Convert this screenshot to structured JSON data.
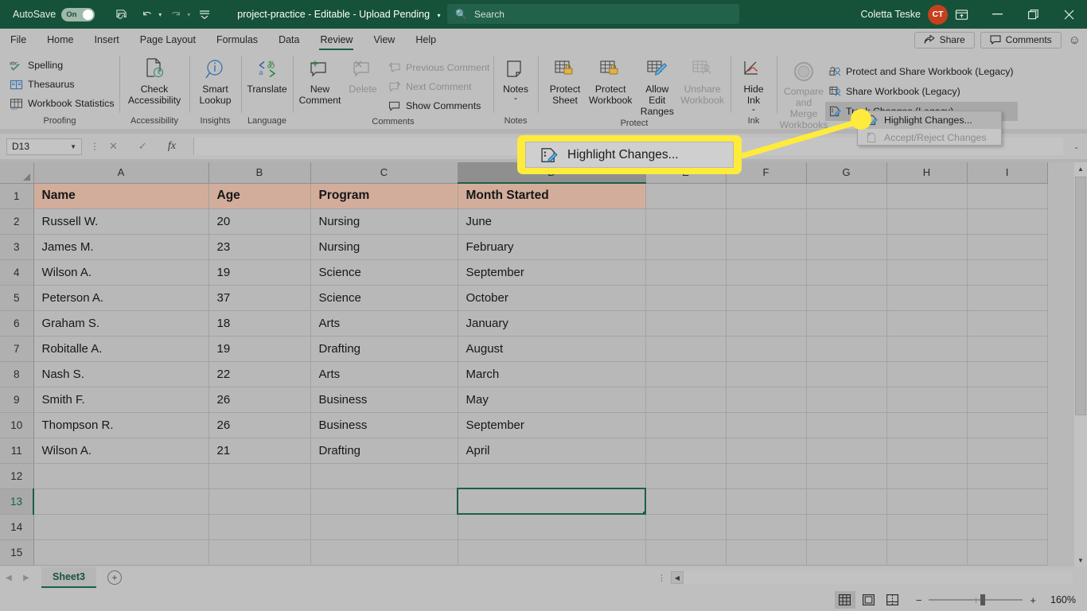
{
  "titlebar": {
    "autosave_label": "AutoSave",
    "autosave_state": "On",
    "save_icon": "save-icon",
    "undo_icon": "undo-icon",
    "redo_icon": "redo-icon",
    "customize_icon": "customize-quick-access-icon",
    "document_title": "project-practice  -  Editable  -  Upload Pending",
    "search_placeholder": "Search",
    "user_name": "Coletta Teske",
    "user_initials": "CT",
    "ribbon_display_icon": "ribbon-display-options-icon",
    "minimize_icon": "minimize-icon",
    "restore_icon": "restore-icon",
    "close_icon": "close-icon"
  },
  "tabs": [
    {
      "label": "File",
      "active": false
    },
    {
      "label": "Home",
      "active": false
    },
    {
      "label": "Insert",
      "active": false
    },
    {
      "label": "Page Layout",
      "active": false
    },
    {
      "label": "Formulas",
      "active": false
    },
    {
      "label": "Data",
      "active": false
    },
    {
      "label": "Review",
      "active": true
    },
    {
      "label": "View",
      "active": false
    },
    {
      "label": "Help",
      "active": false
    }
  ],
  "tab_right": {
    "share_label": "Share",
    "comments_label": "Comments",
    "feedback_icon": "smiley-face-icon"
  },
  "ribbon": {
    "groups": [
      {
        "title": "Proofing",
        "small_items": [
          {
            "label": "Spelling",
            "icon": "spelling-abc-check-icon",
            "disabled": false
          },
          {
            "label": "Thesaurus",
            "icon": "thesaurus-book-icon",
            "disabled": false
          },
          {
            "label": "Workbook Statistics",
            "icon": "workbook-statistics-icon",
            "disabled": false
          }
        ]
      },
      {
        "title": "Accessibility",
        "big_items": [
          {
            "label": "Check\nAccessibility",
            "icon": "check-accessibility-icon",
            "disabled": false
          }
        ]
      },
      {
        "title": "Insights",
        "big_items": [
          {
            "label": "Smart\nLookup",
            "icon": "smart-lookup-icon",
            "disabled": false
          }
        ]
      },
      {
        "title": "Language",
        "big_items": [
          {
            "label": "Translate",
            "icon": "translate-icon",
            "disabled": false
          }
        ]
      },
      {
        "title": "Comments",
        "big_items": [
          {
            "label": "New\nComment",
            "icon": "new-comment-icon",
            "disabled": false
          },
          {
            "label": "Delete",
            "icon": "delete-comment-icon",
            "disabled": true
          }
        ],
        "small_items": [
          {
            "label": "Previous Comment",
            "icon": "previous-comment-icon",
            "disabled": true
          },
          {
            "label": "Next Comment",
            "icon": "next-comment-icon",
            "disabled": true
          },
          {
            "label": "Show Comments",
            "icon": "show-comments-icon",
            "disabled": false
          }
        ]
      },
      {
        "title": "Notes",
        "big_items": [
          {
            "label": "Notes",
            "icon": "notes-icon",
            "disabled": false,
            "caret": true
          }
        ]
      },
      {
        "title": "Protect",
        "big_items": [
          {
            "label": "Protect\nSheet",
            "icon": "protect-sheet-icon",
            "disabled": false
          },
          {
            "label": "Protect\nWorkbook",
            "icon": "protect-workbook-icon",
            "disabled": false
          },
          {
            "label": "Allow Edit\nRanges",
            "icon": "allow-edit-ranges-icon",
            "disabled": false
          },
          {
            "label": "Unshare\nWorkbook",
            "icon": "unshare-workbook-icon",
            "disabled": true
          }
        ]
      },
      {
        "title": "Ink",
        "big_items": [
          {
            "label": "Hide\nInk",
            "icon": "hide-ink-icon",
            "disabled": false,
            "caret": true
          }
        ]
      },
      {
        "title": "",
        "big_items": [
          {
            "label": "Compare and\nMerge Workbooks",
            "icon": "compare-merge-workbooks-icon",
            "disabled": true
          }
        ],
        "small_items": [
          {
            "label": "Protect and Share Workbook (Legacy)",
            "icon": "protect-share-workbook-icon",
            "disabled": false
          },
          {
            "label": "Share Workbook (Legacy)",
            "icon": "share-workbook-icon",
            "disabled": false
          },
          {
            "label": "Track Changes (Legacy)",
            "icon": "track-changes-icon",
            "disabled": false,
            "highlighted": true,
            "caret": true
          }
        ]
      }
    ]
  },
  "dropdown": {
    "items": [
      {
        "label": "Highlight Changes...",
        "icon": "highlight-changes-icon",
        "highlighted": true,
        "disabled": false
      },
      {
        "label": "Accept/Reject Changes",
        "icon": "accept-reject-changes-icon",
        "highlighted": false,
        "disabled": true
      }
    ]
  },
  "callout": {
    "label": "Highlight Changes...",
    "icon": "highlight-changes-icon",
    "border_color": "#ffeb3b"
  },
  "formulabar": {
    "namebox_value": "D13",
    "cancel_icon": "cancel-icon",
    "enter_icon": "confirm-checkmark-icon",
    "function_icon": "insert-function-fx-icon",
    "formula_value": "",
    "expand_icon": "expand-formula-bar-icon"
  },
  "grid": {
    "columns": [
      "A",
      "B",
      "C",
      "D",
      "E",
      "F",
      "G",
      "H",
      "I"
    ],
    "selected_column": "D",
    "selected_row": 13,
    "selected_cell": "D13",
    "rows": [
      {
        "num": 1,
        "cells": [
          "Name",
          "Age",
          "Program",
          "Month Started",
          "",
          "",
          "",
          "",
          ""
        ],
        "header": true
      },
      {
        "num": 2,
        "cells": [
          "Russell W.",
          "20",
          "Nursing",
          "June",
          "",
          "",
          "",
          "",
          ""
        ]
      },
      {
        "num": 3,
        "cells": [
          "James M.",
          "23",
          "Nursing",
          "February",
          "",
          "",
          "",
          "",
          ""
        ]
      },
      {
        "num": 4,
        "cells": [
          "Wilson A.",
          "19",
          "Science",
          "September",
          "",
          "",
          "",
          "",
          ""
        ]
      },
      {
        "num": 5,
        "cells": [
          "Peterson A.",
          "37",
          "Science",
          "October",
          "",
          "",
          "",
          "",
          ""
        ]
      },
      {
        "num": 6,
        "cells": [
          "Graham S.",
          "18",
          "Arts",
          "January",
          "",
          "",
          "",
          "",
          ""
        ]
      },
      {
        "num": 7,
        "cells": [
          "Robitalle A.",
          "19",
          "Drafting",
          "August",
          "",
          "",
          "",
          "",
          ""
        ]
      },
      {
        "num": 8,
        "cells": [
          "Nash S.",
          "22",
          "Arts",
          "March",
          "",
          "",
          "",
          "",
          ""
        ]
      },
      {
        "num": 9,
        "cells": [
          "Smith F.",
          "26",
          "Business",
          "May",
          "",
          "",
          "",
          "",
          ""
        ]
      },
      {
        "num": 10,
        "cells": [
          "Thompson R.",
          "26",
          "Business",
          "September",
          "",
          "",
          "",
          "",
          ""
        ]
      },
      {
        "num": 11,
        "cells": [
          "Wilson A.",
          "21",
          "Drafting",
          "April",
          "",
          "",
          "",
          "",
          ""
        ]
      },
      {
        "num": 12,
        "cells": [
          "",
          "",
          "",
          "",
          "",
          "",
          "",
          "",
          ""
        ]
      },
      {
        "num": 13,
        "cells": [
          "",
          "",
          "",
          "",
          "",
          "",
          "",
          "",
          ""
        ]
      },
      {
        "num": 14,
        "cells": [
          "",
          "",
          "",
          "",
          "",
          "",
          "",
          "",
          ""
        ]
      },
      {
        "num": 15,
        "cells": [
          "",
          "",
          "",
          "",
          "",
          "",
          "",
          "",
          ""
        ]
      }
    ],
    "header_fill_color": "#d3ad9b"
  },
  "sheetbar": {
    "prev_icon": "nav-previous-sheet-icon",
    "next_icon": "nav-next-sheet-icon",
    "sheets": [
      {
        "label": "Sheet3",
        "active": true
      }
    ],
    "add_sheet_icon": "add-sheet-plus-icon"
  },
  "statusbar": {
    "normal_view_icon": "normal-view-icon",
    "page_layout_icon": "page-layout-view-icon",
    "page_break_icon": "page-break-preview-icon",
    "zoom_out_label": "−",
    "zoom_in_label": "+",
    "zoom_level": "160%"
  }
}
